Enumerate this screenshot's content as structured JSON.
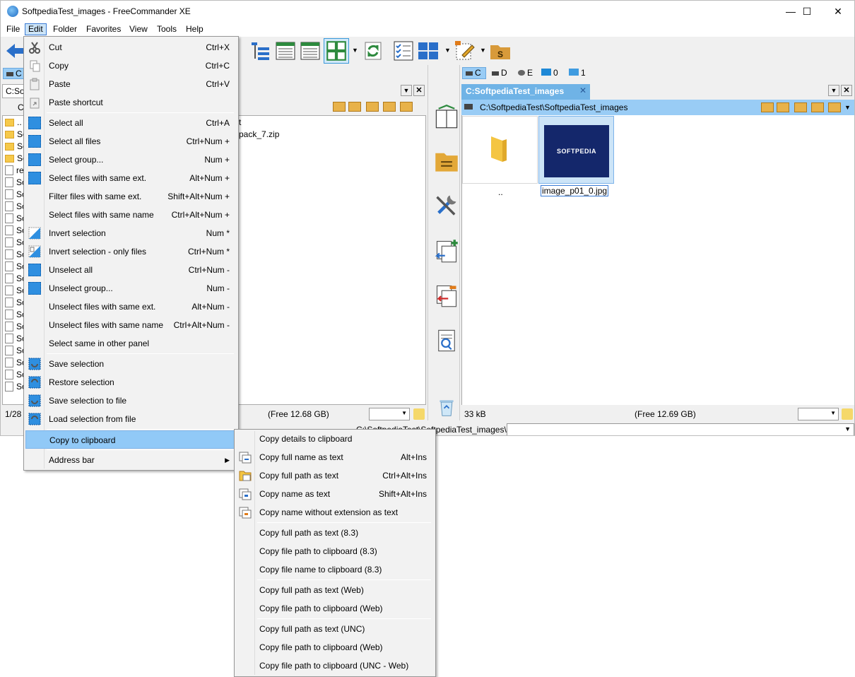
{
  "window": {
    "title": "SoftpediaTest_images - FreeCommander XE"
  },
  "menubar": [
    "File",
    "Edit",
    "Folder",
    "Favorites",
    "View",
    "Tools",
    "Help"
  ],
  "left_panel": {
    "drive_label": "C",
    "tab_label": "C:So",
    "path_prefix": "C",
    "rows": [
      "..",
      "So",
      "So",
      "So",
      "rea",
      "So",
      "So",
      "So",
      "So",
      "So",
      "So",
      "So",
      "So",
      "So",
      "So",
      "So",
      "So",
      "So",
      "So",
      "So",
      "So",
      "So",
      "So",
      "So"
    ],
    "visible_fragments": [
      "t",
      "pack_7.zip"
    ],
    "status_count": "1/28",
    "free_space": "(Free 12.68 GB)"
  },
  "right_panel": {
    "drives": [
      {
        "label": "C"
      },
      {
        "label": "D"
      },
      {
        "label": "E"
      },
      {
        "label": "0"
      },
      {
        "label": "1"
      }
    ],
    "tab_label": "C:SoftpediaTest_images",
    "path": "C:\\SoftpediaTest\\SoftpediaTest_images",
    "items": [
      {
        "name": "..",
        "kind": "parent-folder"
      },
      {
        "name": "image_p01_0.jpg",
        "kind": "image",
        "thumb_text": "SOFTPEDIA"
      }
    ],
    "status_size": "33 kB",
    "free_space": "(Free 12.69 GB)"
  },
  "command_line": {
    "path": "C:\\SoftpediaTest\\SoftpediaTest_images\\"
  },
  "edit_menu": [
    {
      "label": "Cut",
      "shortcut": "Ctrl+X"
    },
    {
      "label": "Copy",
      "shortcut": "Ctrl+C"
    },
    {
      "label": "Paste",
      "shortcut": "Ctrl+V"
    },
    {
      "label": "Paste shortcut",
      "shortcut": ""
    },
    {
      "label": "Select all",
      "shortcut": "Ctrl+A"
    },
    {
      "label": "Select all files",
      "shortcut": "Ctrl+Num +"
    },
    {
      "label": "Select group...",
      "shortcut": "Num +"
    },
    {
      "label": "Select files with same ext.",
      "shortcut": "Alt+Num +"
    },
    {
      "label": "Filter files with same ext.",
      "shortcut": "Shift+Alt+Num +"
    },
    {
      "label": "Select files with same name",
      "shortcut": "Ctrl+Alt+Num +"
    },
    {
      "label": "Invert selection",
      "shortcut": "Num *"
    },
    {
      "label": "Invert selection - only files",
      "shortcut": "Ctrl+Num *"
    },
    {
      "label": "Unselect all",
      "shortcut": "Ctrl+Num -"
    },
    {
      "label": "Unselect group...",
      "shortcut": "Num -"
    },
    {
      "label": "Unselect files with same ext.",
      "shortcut": "Alt+Num -"
    },
    {
      "label": "Unselect files with same name",
      "shortcut": "Ctrl+Alt+Num -"
    },
    {
      "label": "Select same in other panel",
      "shortcut": ""
    },
    {
      "label": "Save selection",
      "shortcut": ""
    },
    {
      "label": "Restore selection",
      "shortcut": ""
    },
    {
      "label": "Save selection to file",
      "shortcut": ""
    },
    {
      "label": "Load selection from file",
      "shortcut": ""
    },
    {
      "label": "Copy to clipboard",
      "shortcut": ""
    },
    {
      "label": "Address bar",
      "shortcut": ""
    }
  ],
  "clipboard_submenu": [
    {
      "label": "Copy details to clipboard",
      "shortcut": ""
    },
    {
      "label": "Copy full name as text",
      "shortcut": "Alt+Ins"
    },
    {
      "label": "Copy full path as text",
      "shortcut": "Ctrl+Alt+Ins"
    },
    {
      "label": "Copy name as text",
      "shortcut": "Shift+Alt+Ins"
    },
    {
      "label": "Copy name without extension as text",
      "shortcut": ""
    },
    {
      "label": "Copy full path as text (8.3)",
      "shortcut": ""
    },
    {
      "label": "Copy file path to clipboard (8.3)",
      "shortcut": ""
    },
    {
      "label": "Copy file name to clipboard (8.3)",
      "shortcut": ""
    },
    {
      "label": "Copy full path as text (Web)",
      "shortcut": ""
    },
    {
      "label": "Copy file path to clipboard (Web)",
      "shortcut": ""
    },
    {
      "label": "Copy full path as text (UNC)",
      "shortcut": ""
    },
    {
      "label": "Copy file path to clipboard (Web)",
      "shortcut": ""
    },
    {
      "label": "Copy file path to clipboard (UNC - Web)",
      "shortcut": ""
    }
  ],
  "colors": {
    "accent": "#91c9f7",
    "path_bar": "#99ccf5",
    "tab_active": "#6fb3e6"
  }
}
